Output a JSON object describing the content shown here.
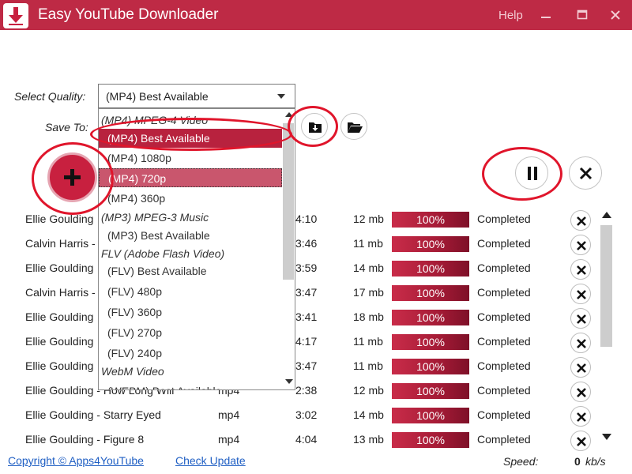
{
  "window": {
    "title": "Easy YouTube Downloader",
    "help_label": "Help",
    "accent_color": "#be2a45"
  },
  "quality": {
    "label": "Select Quality:",
    "selected": "(MP4) Best Available",
    "options": [
      {
        "kind": "group",
        "label": "(MP4) MPEG-4 Video"
      },
      {
        "kind": "item",
        "label": "(MP4) Best Available",
        "state": "selected"
      },
      {
        "kind": "item",
        "label": "(MP4) 1080p"
      },
      {
        "kind": "item",
        "label": "(MP4) 720p",
        "state": "hover"
      },
      {
        "kind": "item",
        "label": "(MP4) 360p"
      },
      {
        "kind": "group",
        "label": "(MP3) MPEG-3 Music"
      },
      {
        "kind": "item",
        "label": "(MP3) Best Available"
      },
      {
        "kind": "group",
        "label": "FLV (Adobe Flash Video)"
      },
      {
        "kind": "item",
        "label": "(FLV) Best Available"
      },
      {
        "kind": "item",
        "label": "(FLV) 480p"
      },
      {
        "kind": "item",
        "label": "(FLV) 360p"
      },
      {
        "kind": "item",
        "label": "(FLV) 270p"
      },
      {
        "kind": "item",
        "label": "(FLV) 240p"
      },
      {
        "kind": "group",
        "label": "WebM Video"
      },
      {
        "kind": "item",
        "label": "(WEBM) Best Available"
      }
    ]
  },
  "save": {
    "label": "Save To:"
  },
  "icons": {
    "logo": "download-arrow-icon",
    "save_folder": "folder-download-icon",
    "open_folder": "folder-open-icon",
    "add": "plus-icon",
    "pause": "pause-icon",
    "cancel_all": "close-icon",
    "remove": "close-icon"
  },
  "downloads": [
    {
      "title": "Ellie Goulding",
      "format": "",
      "duration": "4:10",
      "size": "12 mb",
      "progress": "100%",
      "status": "Completed"
    },
    {
      "title": "Calvin Harris -",
      "format": "",
      "duration": "3:46",
      "size": "11 mb",
      "progress": "100%",
      "status": "Completed"
    },
    {
      "title": "Ellie Goulding",
      "format": "",
      "duration": "3:59",
      "size": "14 mb",
      "progress": "100%",
      "status": "Completed"
    },
    {
      "title": "Calvin Harris -",
      "format": "",
      "duration": "3:47",
      "size": "17 mb",
      "progress": "100%",
      "status": "Completed"
    },
    {
      "title": "Ellie Goulding",
      "format": "",
      "duration": "3:41",
      "size": "18 mb",
      "progress": "100%",
      "status": "Completed"
    },
    {
      "title": "Ellie Goulding",
      "format": "",
      "duration": "4:17",
      "size": "11 mb",
      "progress": "100%",
      "status": "Completed"
    },
    {
      "title": "Ellie Goulding",
      "format": "",
      "duration": "3:47",
      "size": "11 mb",
      "progress": "100%",
      "status": "Completed"
    },
    {
      "title": "Ellie Goulding - How Long Will",
      "format": "mp4",
      "duration": "2:38",
      "size": "12 mb",
      "progress": "100%",
      "status": "Completed"
    },
    {
      "title": "Ellie Goulding - Starry Eyed",
      "format": "mp4",
      "duration": "3:02",
      "size": "14 mb",
      "progress": "100%",
      "status": "Completed"
    },
    {
      "title": "Ellie Goulding - Figure 8",
      "format": "mp4",
      "duration": "4:04",
      "size": "13 mb",
      "progress": "100%",
      "status": "Completed"
    }
  ],
  "footer": {
    "copyright": "Copyright © Apps4YouTube",
    "check_update": "Check Update",
    "speed_label": "Speed:",
    "speed_value": "0",
    "speed_unit": "kb/s"
  }
}
